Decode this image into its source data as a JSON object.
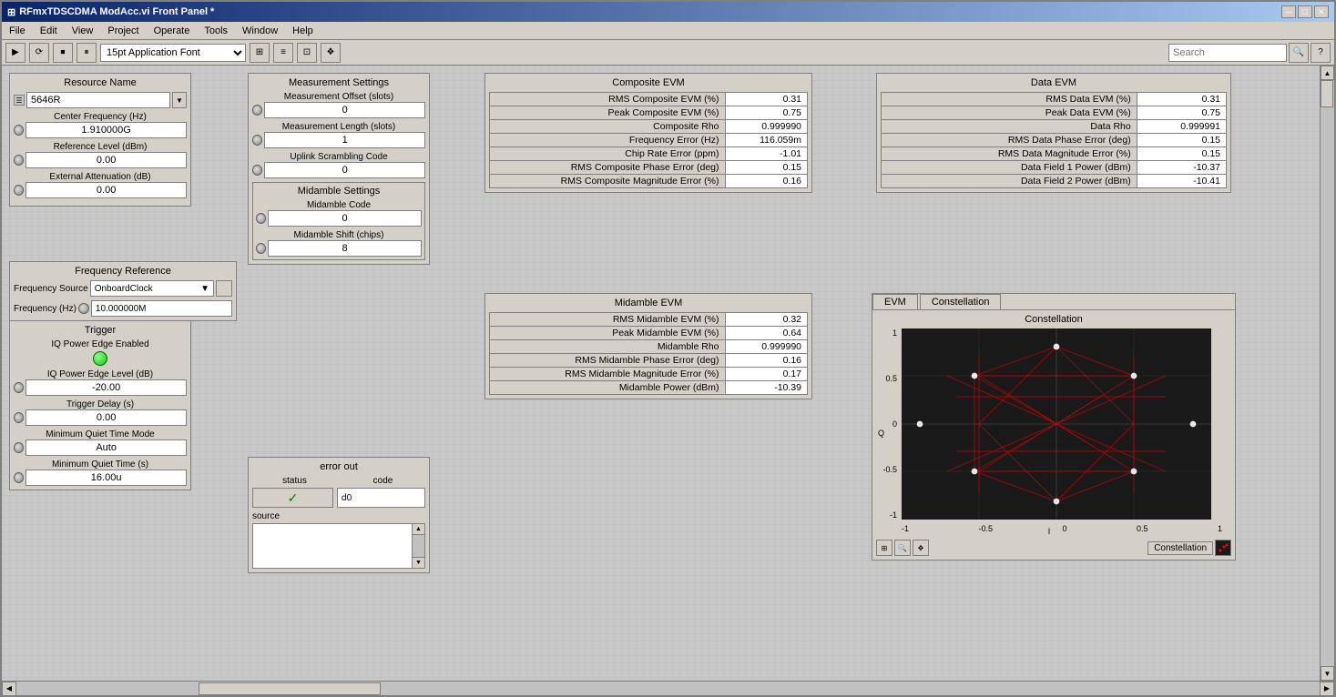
{
  "window": {
    "title": "RFmxTDSCDMA ModAcc.vi Front Panel *",
    "icon": "☰"
  },
  "menu": {
    "items": [
      "File",
      "Edit",
      "View",
      "Project",
      "Operate",
      "Tools",
      "Window",
      "Help"
    ]
  },
  "toolbar": {
    "font_select": "15pt Application Font",
    "search_placeholder": "Search"
  },
  "resource_name": {
    "title": "Resource Name",
    "value": "5646R"
  },
  "center_frequency": {
    "label": "Center Frequency (Hz)",
    "value": "1.910000G"
  },
  "reference_level": {
    "label": "Reference Level (dBm)",
    "value": "0.00"
  },
  "external_attenuation": {
    "label": "External Attenuation (dB)",
    "value": "0.00"
  },
  "frequency_reference": {
    "title": "Frequency Reference",
    "source_label": "Frequency Source",
    "source_value": "OnboardClock",
    "freq_label": "Frequency (Hz)",
    "freq_value": "10.000000M"
  },
  "trigger": {
    "title": "Trigger",
    "iq_power_edge_label": "IQ Power Edge Enabled",
    "iq_power_level_label": "IQ Power Edge Level (dB)",
    "iq_power_level_value": "-20.00",
    "trigger_delay_label": "Trigger Delay (s)",
    "trigger_delay_value": "0.00",
    "min_quiet_mode_label": "Minimum Quiet Time Mode",
    "min_quiet_mode_value": "Auto",
    "min_quiet_time_label": "Minimum Quiet Time (s)",
    "min_quiet_time_value": "16.00u"
  },
  "measurement_settings": {
    "title": "Measurement Settings",
    "offset_label": "Measurement Offset (slots)",
    "offset_value": "0",
    "length_label": "Measurement Length (slots)",
    "length_value": "1",
    "scrambling_label": "Uplink Scrambling Code",
    "scrambling_value": "0",
    "midamble_title": "Midamble Settings",
    "midamble_code_label": "Midamble Code",
    "midamble_code_value": "0",
    "midamble_shift_label": "Midamble Shift (chips)",
    "midamble_shift_value": "8"
  },
  "composite_evm": {
    "title": "Composite EVM",
    "rows": [
      {
        "label": "RMS Composite EVM (%)",
        "value": "0.31"
      },
      {
        "label": "Peak Composite EVM (%)",
        "value": "0.75"
      },
      {
        "label": "Composite Rho",
        "value": "0.999990"
      },
      {
        "label": "Frequency Error (Hz)",
        "value": "116.059m"
      },
      {
        "label": "Chip Rate Error (ppm)",
        "value": "-1.01"
      },
      {
        "label": "RMS Composite Phase Error (deg)",
        "value": "0.15"
      },
      {
        "label": "RMS Composite Magnitude Error (%)",
        "value": "0.16"
      }
    ]
  },
  "data_evm": {
    "title": "Data EVM",
    "rows": [
      {
        "label": "RMS Data EVM (%)",
        "value": "0.31"
      },
      {
        "label": "Peak Data EVM (%)",
        "value": "0.75"
      },
      {
        "label": "Data Rho",
        "value": "0.999991"
      },
      {
        "label": "RMS Data Phase Error (deg)",
        "value": "0.15"
      },
      {
        "label": "RMS Data Magnitude Error (%)",
        "value": "0.15"
      },
      {
        "label": "Data Field 1 Power (dBm)",
        "value": "-10.37"
      },
      {
        "label": "Data Field 2 Power (dBm)",
        "value": "-10.41"
      }
    ]
  },
  "midamble_evm": {
    "title": "Midamble EVM",
    "rows": [
      {
        "label": "RMS Midamble EVM (%)",
        "value": "0.32"
      },
      {
        "label": "Peak Midamble EVM (%)",
        "value": "0.64"
      },
      {
        "label": "Midamble Rho",
        "value": "0.999990"
      },
      {
        "label": "RMS Midamble Phase Error (deg)",
        "value": "0.16"
      },
      {
        "label": "RMS Midamble Magnitude Error (%)",
        "value": "0.17"
      },
      {
        "label": "Midamble Power (dBm)",
        "value": "-10.39"
      }
    ]
  },
  "evm_tab": {
    "label": "EVM"
  },
  "constellation_tab": {
    "label": "Constellation",
    "title": "Constellation",
    "x_axis_label": "I",
    "y_axis_label": "Q",
    "x_ticks": [
      "-1",
      "-0.5",
      "0",
      "0.5",
      "1"
    ],
    "y_ticks": [
      "1",
      "0.5",
      "0",
      "-0.5",
      "-1"
    ]
  },
  "error_out": {
    "title": "error out",
    "status_label": "status",
    "code_label": "code",
    "code_value": "0",
    "source_label": "source"
  }
}
